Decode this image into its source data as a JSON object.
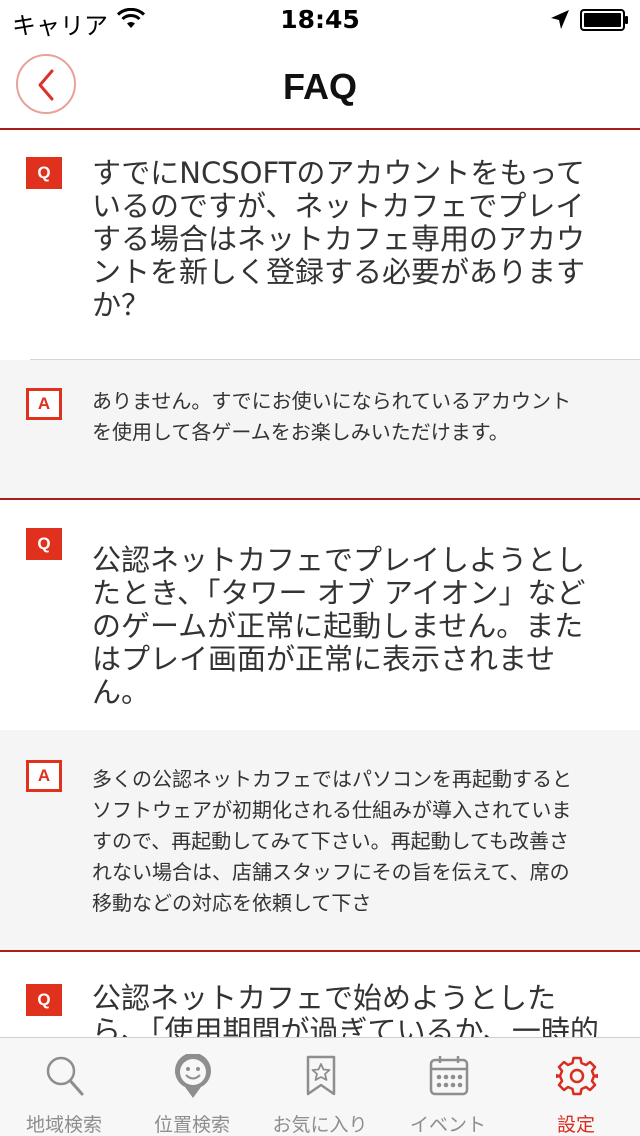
{
  "status_bar": {
    "carrier": "キャリア",
    "time": "18:45"
  },
  "nav": {
    "title": "FAQ",
    "back_icon": "chevron-left-icon"
  },
  "colors": {
    "accent": "#e0301e",
    "divider_red": "#a81d1d",
    "answer_bg": "#f5f5f5"
  },
  "faq": [
    {
      "q_badge": "Q",
      "question": "すでにNCSOFTのアカウントをもっているのですが、ネットカフェでプレイする場合はネットカフェ専用のアカウントを新しく登録する必要がありますか？",
      "a_badge": "A",
      "answer": "ありません。すでにお使いになられているアカウントを使用して各ゲームをお楽しみいただけます。"
    },
    {
      "q_badge": "Q",
      "question": "公認ネットカフェでプレイしようとしたとき、「タワー オブ アイオン」などのゲームが正常に起動しません。またはプレイ画面が正常に表示されません。",
      "a_badge": "A",
      "answer": "多くの公認ネットカフェではパソコンを再起動するとソフトウェアが初期化される仕組みが導入されていますので、再起動してみて下さい。再起動しても改善されない場合は、店舗スタッフにその旨を伝えて、席の移動などの対応を依頼して下さ"
    },
    {
      "q_badge": "Q",
      "question": "公認ネットカフェで始めようとしたら、「使用期間が過ぎているか、一時的な接"
    }
  ],
  "tabs": [
    {
      "label": "地域検索",
      "icon": "magnifier-icon",
      "active": false
    },
    {
      "label": "位置検索",
      "icon": "location-pin-icon",
      "active": false
    },
    {
      "label": "お気に入り",
      "icon": "bookmark-star-icon",
      "active": false
    },
    {
      "label": "イベント",
      "icon": "calendar-icon",
      "active": false
    },
    {
      "label": "設定",
      "icon": "gear-icon",
      "active": true
    }
  ]
}
